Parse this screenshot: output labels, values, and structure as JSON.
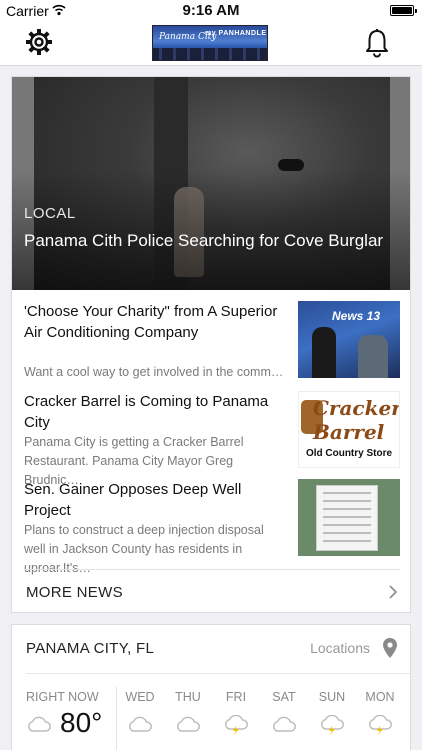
{
  "status_bar": {
    "carrier": "Carrier",
    "time": "9:16 AM",
    "battery_level_percent": 100
  },
  "nav": {
    "logo_alt": "my PANHANDLE",
    "icons": [
      "gear-icon",
      "bell-icon"
    ]
  },
  "hero": {
    "category": "LOCAL",
    "title": "Panama Cith Police Searching for Cove Burglar"
  },
  "stories": [
    {
      "title": "'Choose Your Charity\" from A Superior Air Conditioning Company",
      "summary": "Want a cool way to get involved in the comm…",
      "thumb_text": "News 13"
    },
    {
      "title": "Cracker Barrel is Coming to Panama City",
      "summary": "Panama City is getting a Cracker Barrel Restaurant. Panama City Mayor Greg Brudnic…",
      "thumb_text": "Cracker Barrel",
      "thumb_subtext": "Old Country Store"
    },
    {
      "title": "Sen. Gainer Opposes Deep Well Project",
      "summary": "Plans to construct a deep injection disposal well in Jackson County has residents in uproar.It's…"
    }
  ],
  "more_news": {
    "label": "MORE NEWS"
  },
  "weather": {
    "city": "PANAMA CITY, FL",
    "locations_label": "Locations",
    "now_label": "RIGHT NOW",
    "now_temp": "80°",
    "now_icon": "cloud-icon",
    "days": [
      {
        "label": "WED",
        "icon": "cloud-icon"
      },
      {
        "label": "THU",
        "icon": "cloud-icon"
      },
      {
        "label": "FRI",
        "icon": "thunderstorm-icon"
      },
      {
        "label": "SAT",
        "icon": "cloud-icon"
      },
      {
        "label": "SUN",
        "icon": "thunderstorm-icon"
      },
      {
        "label": "MON",
        "icon": "thunderstorm-icon"
      }
    ],
    "colors": {
      "lightning": "#f2c200",
      "icon_stroke": "#bdbdbd"
    }
  }
}
